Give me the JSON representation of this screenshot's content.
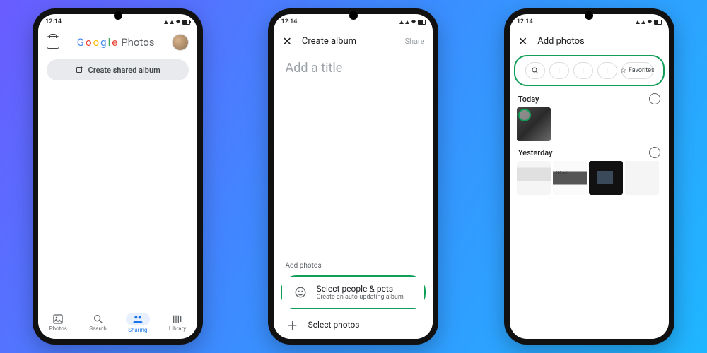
{
  "status": {
    "time": "12:14"
  },
  "phone1": {
    "app_title_plain": "Photos",
    "google": [
      "G",
      "o",
      "o",
      "g",
      "l",
      "e"
    ],
    "create_button": "Create shared album",
    "nav": {
      "photos": "Photos",
      "search": "Search",
      "sharing": "Sharing",
      "library": "Library"
    }
  },
  "phone2": {
    "toolbar_title": "Create album",
    "share": "Share",
    "title_placeholder": "Add a title",
    "add_photos_label": "Add photos",
    "option1_title": "Select people & pets",
    "option1_sub": "Create an auto-updating album",
    "option2_title": "Select photos"
  },
  "phone3": {
    "toolbar_title": "Add photos",
    "favorites": "Favorites",
    "section_today": "Today",
    "section_yesterday": "Yesterday"
  }
}
